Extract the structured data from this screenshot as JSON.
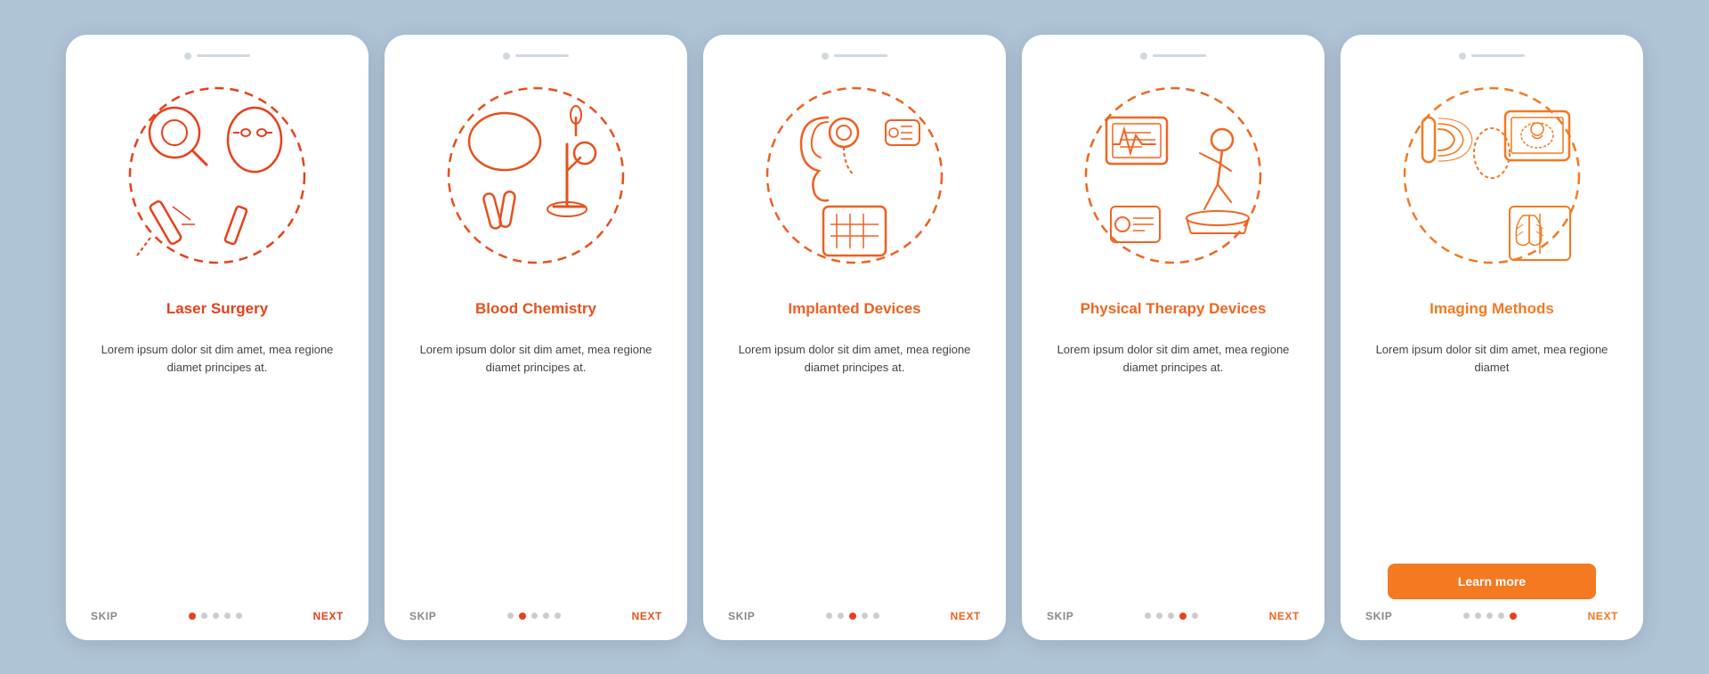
{
  "screens": [
    {
      "id": "screen-1",
      "title": "Laser Surgery",
      "body": "Lorem ipsum dolor sit dim amet, mea regione diamet principes at.",
      "activeDot": 1,
      "skipLabel": "SKIP",
      "nextLabel": "NEXT",
      "iconColor": "#e8401a",
      "hasLearnMore": false,
      "colorStart": "#e8401a",
      "colorEnd": "#e8401a"
    },
    {
      "id": "screen-2",
      "title": "Blood Chemistry",
      "body": "Lorem ipsum dolor sit dim amet, mea regione diamet principes at.",
      "activeDot": 2,
      "skipLabel": "SKIP",
      "nextLabel": "NEXT",
      "iconColor": "#e8501a",
      "hasLearnMore": false
    },
    {
      "id": "screen-3",
      "title": "Implanted Devices",
      "body": "Lorem ipsum dolor sit dim amet, mea regione diamet principes at.",
      "activeDot": 3,
      "skipLabel": "SKIP",
      "nextLabel": "NEXT",
      "iconColor": "#ef6020",
      "hasLearnMore": false
    },
    {
      "id": "screen-4",
      "title": "Physical Therapy Devices",
      "body": "Lorem ipsum dolor sit dim amet, mea regione diamet principes at.",
      "activeDot": 4,
      "skipLabel": "SKIP",
      "nextLabel": "NEXT",
      "iconColor": "#f06520",
      "hasLearnMore": false
    },
    {
      "id": "screen-5",
      "title": "Imaging Methods",
      "body": "Lorem ipsum dolor sit dim amet, mea regione diamet",
      "activeDot": 5,
      "skipLabel": "SKIP",
      "nextLabel": "NEXT",
      "iconColor": "#f47920",
      "hasLearnMore": true,
      "learnMoreLabel": "Learn more"
    }
  ],
  "dotCount": 5
}
